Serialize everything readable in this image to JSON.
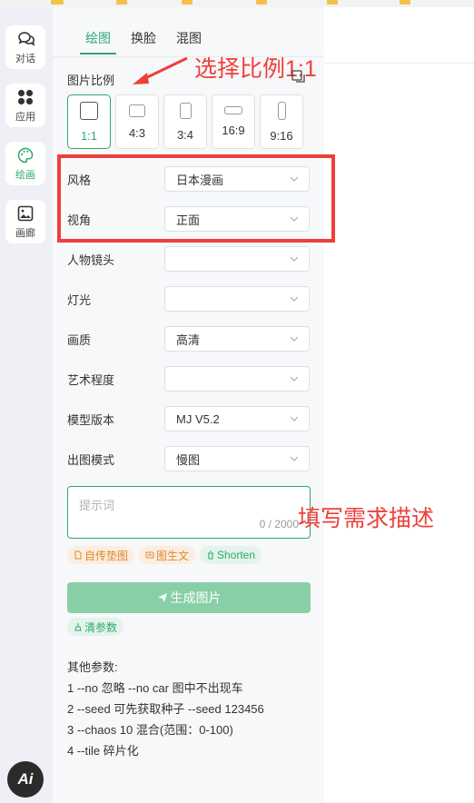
{
  "rail": [
    {
      "label": "对话",
      "icon": "chat-icon",
      "active": false
    },
    {
      "label": "应用",
      "icon": "apps-grid-icon",
      "active": false
    },
    {
      "label": "绘画",
      "icon": "palette-icon",
      "active": true
    },
    {
      "label": "画廊",
      "icon": "gallery-image-icon",
      "active": false
    }
  ],
  "logo_text": "Ai",
  "tabs": [
    {
      "label": "绘图",
      "active": true
    },
    {
      "label": "换脸",
      "active": false
    },
    {
      "label": "混图",
      "active": false
    }
  ],
  "ratio": {
    "label": "图片比例",
    "options": [
      {
        "label": "1:1",
        "active": true
      },
      {
        "label": "4:3",
        "active": false
      },
      {
        "label": "3:4",
        "active": false
      },
      {
        "label": "16:9",
        "active": false
      },
      {
        "label": "9:16",
        "active": false
      }
    ]
  },
  "fields": [
    {
      "label": "风格",
      "value": "日本漫画"
    },
    {
      "label": "视角",
      "value": "正面"
    },
    {
      "label": "人物镜头",
      "value": ""
    },
    {
      "label": "灯光",
      "value": ""
    },
    {
      "label": "画质",
      "value": "高清"
    },
    {
      "label": "艺术程度",
      "value": ""
    },
    {
      "label": "模型版本",
      "value": "MJ V5.2"
    },
    {
      "label": "出图模式",
      "value": "慢图"
    }
  ],
  "prompt": {
    "placeholder": "提示词",
    "value": "",
    "counter": "0 / 2000"
  },
  "chips": {
    "upload": "自传垫图",
    "img2text": "图生文",
    "shorten": "Shorten"
  },
  "generate_label": "生成图片",
  "clear_label": "清参数",
  "other_params": {
    "title": "其他参数:",
    "lines": [
      "1 --no 忽略 --no car 图中不出现车",
      "2 --seed 可先获取种子 --seed 123456",
      "3 --chaos 10 混合(范围：0-100)",
      "4 --tile 碎片化"
    ]
  },
  "annotations": {
    "ratio_note": "选择比例1:1",
    "prompt_note": "填写需求描述"
  },
  "colors": {
    "accent": "#2fa870",
    "annotation": "#ee3f3a",
    "button": "#88cfa8"
  }
}
